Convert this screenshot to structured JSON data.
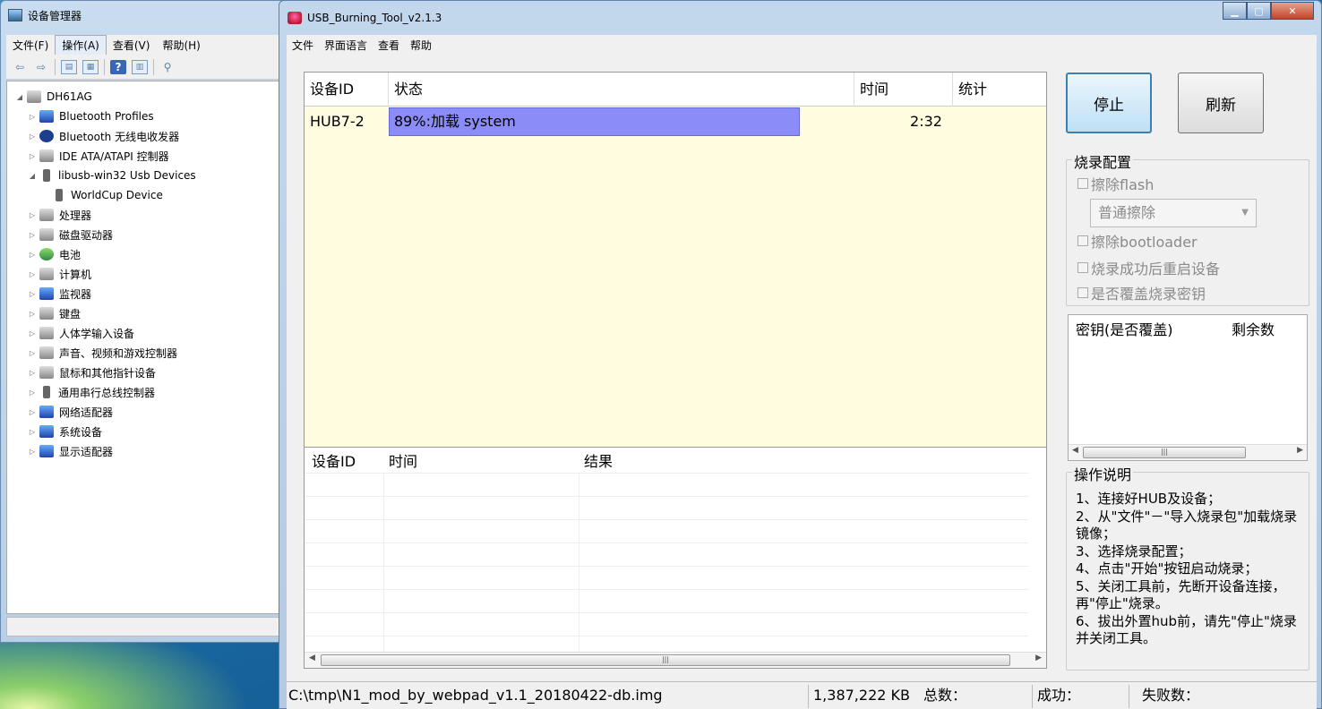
{
  "device_manager": {
    "title": "设备管理器",
    "menu": [
      "文件(F)",
      "操作(A)",
      "查看(V)",
      "帮助(H)"
    ],
    "tree": [
      {
        "label": "DH61AG",
        "level": 0,
        "expander": "◢",
        "icon": "computer-icon"
      },
      {
        "label": "Bluetooth Profiles",
        "level": 1,
        "expander": "▷",
        "icon": "network-icon"
      },
      {
        "label": "Bluetooth 无线电收发器",
        "level": 1,
        "expander": "▷",
        "icon": "bluetooth-icon"
      },
      {
        "label": "IDE ATA/ATAPI 控制器",
        "level": 1,
        "expander": "▷",
        "icon": "ide-controller-icon"
      },
      {
        "label": "libusb-win32 Usb Devices",
        "level": 1,
        "expander": "◢",
        "icon": "usb-icon"
      },
      {
        "label": "WorldCup Device",
        "level": 2,
        "expander": "",
        "icon": "usb-icon"
      },
      {
        "label": "处理器",
        "level": 1,
        "expander": "▷",
        "icon": "processor-icon"
      },
      {
        "label": "磁盘驱动器",
        "level": 1,
        "expander": "▷",
        "icon": "disk-drive-icon"
      },
      {
        "label": "电池",
        "level": 1,
        "expander": "▷",
        "icon": "battery-icon"
      },
      {
        "label": "计算机",
        "level": 1,
        "expander": "▷",
        "icon": "computer-icon"
      },
      {
        "label": "监视器",
        "level": 1,
        "expander": "▷",
        "icon": "monitor-icon"
      },
      {
        "label": "键盘",
        "level": 1,
        "expander": "▷",
        "icon": "keyboard-icon"
      },
      {
        "label": "人体学输入设备",
        "level": 1,
        "expander": "▷",
        "icon": "hid-icon"
      },
      {
        "label": "声音、视频和游戏控制器",
        "level": 1,
        "expander": "▷",
        "icon": "speaker-icon"
      },
      {
        "label": "鼠标和其他指针设备",
        "level": 1,
        "expander": "▷",
        "icon": "mouse-icon"
      },
      {
        "label": "通用串行总线控制器",
        "level": 1,
        "expander": "▷",
        "icon": "usb-icon"
      },
      {
        "label": "网络适配器",
        "level": 1,
        "expander": "▷",
        "icon": "network-icon"
      },
      {
        "label": "系统设备",
        "level": 1,
        "expander": "▷",
        "icon": "system-icon"
      },
      {
        "label": "显示适配器",
        "level": 1,
        "expander": "▷",
        "icon": "display-adapter-icon"
      }
    ]
  },
  "tool": {
    "title": "USB_Burning_Tool_v2.1.3",
    "menu": [
      "文件",
      "界面语言",
      "查看",
      "帮助"
    ],
    "device_table": {
      "headers": [
        "设备ID",
        "状态",
        "时间",
        "统计"
      ],
      "rows": [
        {
          "id": "HUB7-2",
          "status": "89%:加载 system",
          "progress": 0.89,
          "time": "2:32",
          "stat": ""
        }
      ]
    },
    "log_table": {
      "headers": [
        "设备ID",
        "时间",
        "结果"
      ]
    },
    "buttons": {
      "stop": "停止",
      "refresh": "刷新"
    },
    "config": {
      "title": "烧录配置",
      "erase_flash": "擦除flash",
      "erase_mode": "普通擦除",
      "erase_bootloader": "擦除bootloader",
      "reboot_after": "烧录成功后重启设备",
      "overwrite_key": "是否覆盖烧录密钥"
    },
    "key_list": {
      "headers": [
        "密钥(是否覆盖)",
        "剩余数"
      ]
    },
    "instructions": {
      "title": "操作说明",
      "text": "1、连接好HUB及设备；\n2、从\"文件\"－\"导入烧录包\"加载烧录镜像；\n3、选择烧录配置；\n4、点击\"开始\"按钮启动烧录；\n5、关闭工具前，先断开设备连接，再\"停止\"烧录。\n6、拔出外置hub前，请先\"停止\"烧录并关闭工具。"
    },
    "status_bar": {
      "path": "C:\\tmp\\N1_mod_by_webpad_v1.1_20180422-db.img",
      "size": "1,387,222 KB",
      "total_label": "总数：",
      "success_label": "成功：",
      "fail_label": "失败数："
    }
  },
  "colors": {
    "progress": "#8c8cf8",
    "table_bg": "#fffce0",
    "window_frame": "#c3d7ec",
    "close_button": "#c0432a"
  }
}
